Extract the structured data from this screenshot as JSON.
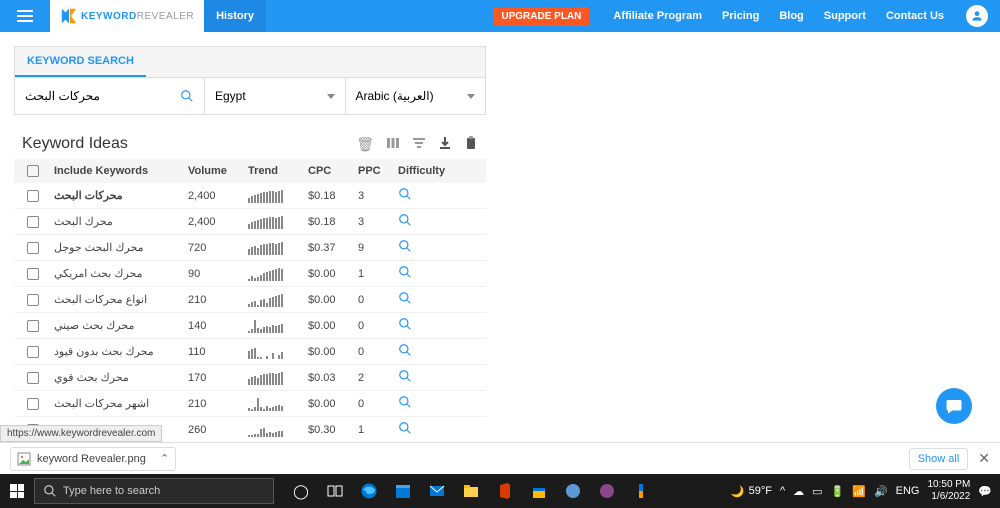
{
  "header": {
    "logo": {
      "bold": "KEYWORD",
      "light": "REVEALER"
    },
    "nav": {
      "history": "History"
    },
    "upgrade": "UPGRADE PLAN",
    "links": {
      "affiliate": "Affiliate Program",
      "pricing": "Pricing",
      "blog": "Blog",
      "support": "Support",
      "contact": "Contact Us"
    }
  },
  "search": {
    "tab": "KEYWORD SEARCH",
    "query": "محركات البحث",
    "country": "Egypt",
    "language": "Arabic (العربية)"
  },
  "table": {
    "title": "Keyword Ideas",
    "columns": {
      "kw": "Include Keywords",
      "vol": "Volume",
      "trend": "Trend",
      "cpc": "CPC",
      "ppc": "PPC",
      "diff": "Difficulty"
    },
    "rows": [
      {
        "kw": "محركات البحث",
        "vol": "2,400",
        "cpc": "$0.18",
        "ppc": "3",
        "trend": [
          5,
          7,
          8,
          9,
          10,
          11,
          11,
          12,
          12,
          11,
          12,
          13
        ],
        "bold": true
      },
      {
        "kw": "محرك البحث",
        "vol": "2,400",
        "cpc": "$0.18",
        "ppc": "3",
        "trend": [
          5,
          7,
          8,
          9,
          10,
          11,
          11,
          12,
          12,
          11,
          12,
          13
        ]
      },
      {
        "kw": "محرك البحث جوجل",
        "vol": "720",
        "cpc": "$0.37",
        "ppc": "9",
        "trend": [
          6,
          8,
          9,
          7,
          10,
          11,
          11,
          12,
          12,
          11,
          12,
          13
        ]
      },
      {
        "kw": "محرك بحث امريكي",
        "vol": "90",
        "cpc": "$0.00",
        "ppc": "1",
        "trend": [
          2,
          5,
          3,
          4,
          6,
          8,
          9,
          10,
          11,
          12,
          13,
          12
        ]
      },
      {
        "kw": "انواع محركات البحث",
        "vol": "210",
        "cpc": "$0.00",
        "ppc": "0",
        "trend": [
          3,
          5,
          6,
          2,
          7,
          8,
          4,
          9,
          10,
          11,
          12,
          13
        ]
      },
      {
        "kw": "محرك بحث صيني",
        "vol": "140",
        "cpc": "$0.00",
        "ppc": "0",
        "trend": [
          2,
          4,
          13,
          5,
          4,
          6,
          7,
          6,
          8,
          7,
          8,
          9
        ]
      },
      {
        "kw": "محرك بحث بدون قيود",
        "vol": "110",
        "cpc": "$0.00",
        "ppc": "0",
        "trend": [
          8,
          10,
          11,
          2,
          2,
          0,
          3,
          0,
          6,
          0,
          4,
          7
        ]
      },
      {
        "kw": "محرك بحث قوي",
        "vol": "170",
        "cpc": "$0.03",
        "ppc": "2",
        "trend": [
          6,
          8,
          9,
          7,
          10,
          11,
          11,
          12,
          12,
          11,
          12,
          13
        ]
      },
      {
        "kw": "اشهر محركات البحث",
        "vol": "210",
        "cpc": "$0.00",
        "ppc": "0",
        "trend": [
          3,
          2,
          4,
          13,
          4,
          2,
          5,
          3,
          4,
          5,
          6,
          5
        ]
      },
      {
        "kw": "",
        "vol": "260",
        "cpc": "$0.30",
        "ppc": "1",
        "trend": [
          2,
          2,
          3,
          3,
          8,
          9,
          4,
          5,
          4,
          5,
          6,
          6
        ]
      }
    ]
  },
  "status_link": "https://www.keywordrevealer.com",
  "downloads": {
    "file": "keyword Revealer.png",
    "show_all": "Show all"
  },
  "taskbar": {
    "search_placeholder": "Type here to search",
    "weather": "59°F",
    "time": "10:50 PM",
    "date": "1/6/2022"
  }
}
